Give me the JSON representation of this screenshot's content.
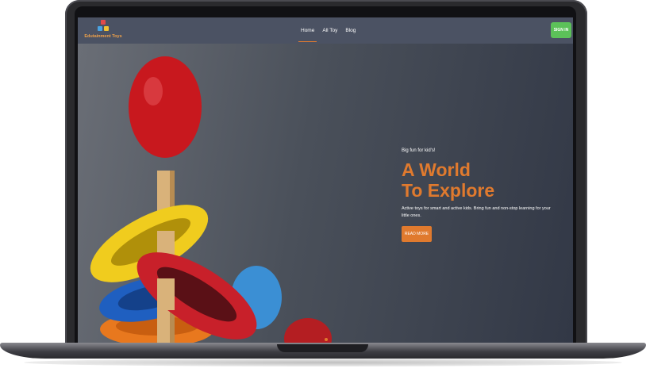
{
  "navbar": {
    "brand_name": "Edutainment Toys",
    "links": [
      {
        "label": "Home",
        "active": true
      },
      {
        "label": "All Toy",
        "active": false
      },
      {
        "label": "Blog",
        "active": false
      }
    ],
    "signin_label": "SIGN IN"
  },
  "hero": {
    "tagline": "Big fun for kid's!",
    "headline_line1": "A World",
    "headline_line2": "To Explore",
    "description": "Active toys for smart and active kids. Bring fun and non-stop learning for your little ones.",
    "cta_label": "READ MORE"
  },
  "colors": {
    "accent": "#e07a2e",
    "signin": "#5cc159",
    "navbar": "#4b5263"
  },
  "icons": [
    "toy-blocks-logo-icon"
  ]
}
